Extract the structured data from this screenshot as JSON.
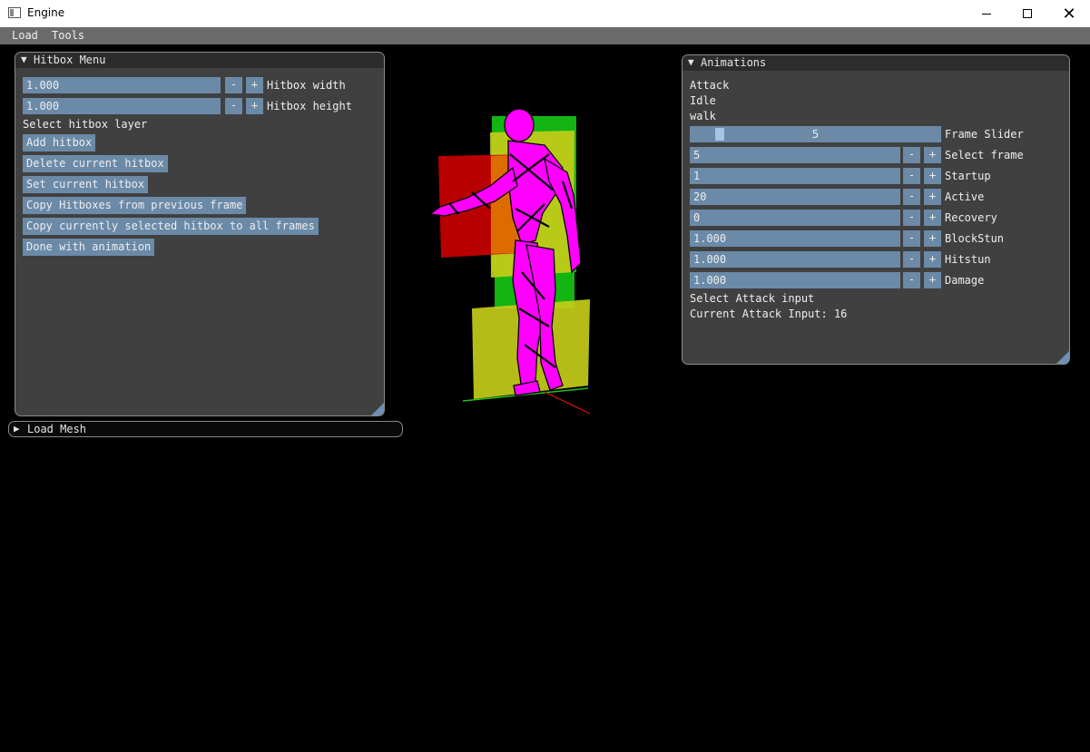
{
  "window": {
    "title": "Engine"
  },
  "menubar": {
    "items": [
      "Load",
      "Tools"
    ]
  },
  "hitbox_menu": {
    "title": "Hitbox Menu",
    "width_value": "1.000",
    "width_label": "Hitbox width",
    "height_value": "1.000",
    "height_label": "Hitbox height",
    "layer_label": "Select hitbox layer",
    "minus": "-",
    "plus": "+",
    "buttons": [
      "Add hitbox",
      "Delete current hitbox",
      "Set current hitbox",
      "Copy Hitboxes from previous frame",
      "Copy currently selected hitbox to all frames",
      "Done with animation"
    ]
  },
  "load_mesh": {
    "title": "Load Mesh"
  },
  "animations": {
    "title": "Animations",
    "list": [
      "Attack",
      "Idle",
      "walk"
    ],
    "frame_slider": {
      "value": "5",
      "label": "Frame Slider",
      "fraction": 0.2
    },
    "fields": [
      {
        "value": "5",
        "label": "Select frame"
      },
      {
        "value": "1",
        "label": "Startup"
      },
      {
        "value": "20",
        "label": "Active"
      },
      {
        "value": "0",
        "label": "Recovery"
      },
      {
        "value": "1.000",
        "label": "BlockStun"
      },
      {
        "value": "1.000",
        "label": "Hitstun"
      },
      {
        "value": "1.000",
        "label": "Damage"
      }
    ],
    "attack_input_label": "Select Attack input",
    "current_attack_input": "Current Attack Input: 16",
    "minus": "-",
    "plus": "+"
  },
  "colors": {
    "hitbox_red": "#cc0000",
    "hitbox_green": "#12b512",
    "hitbox_yellow": "#c6cc19",
    "model": "#ff00ff"
  }
}
